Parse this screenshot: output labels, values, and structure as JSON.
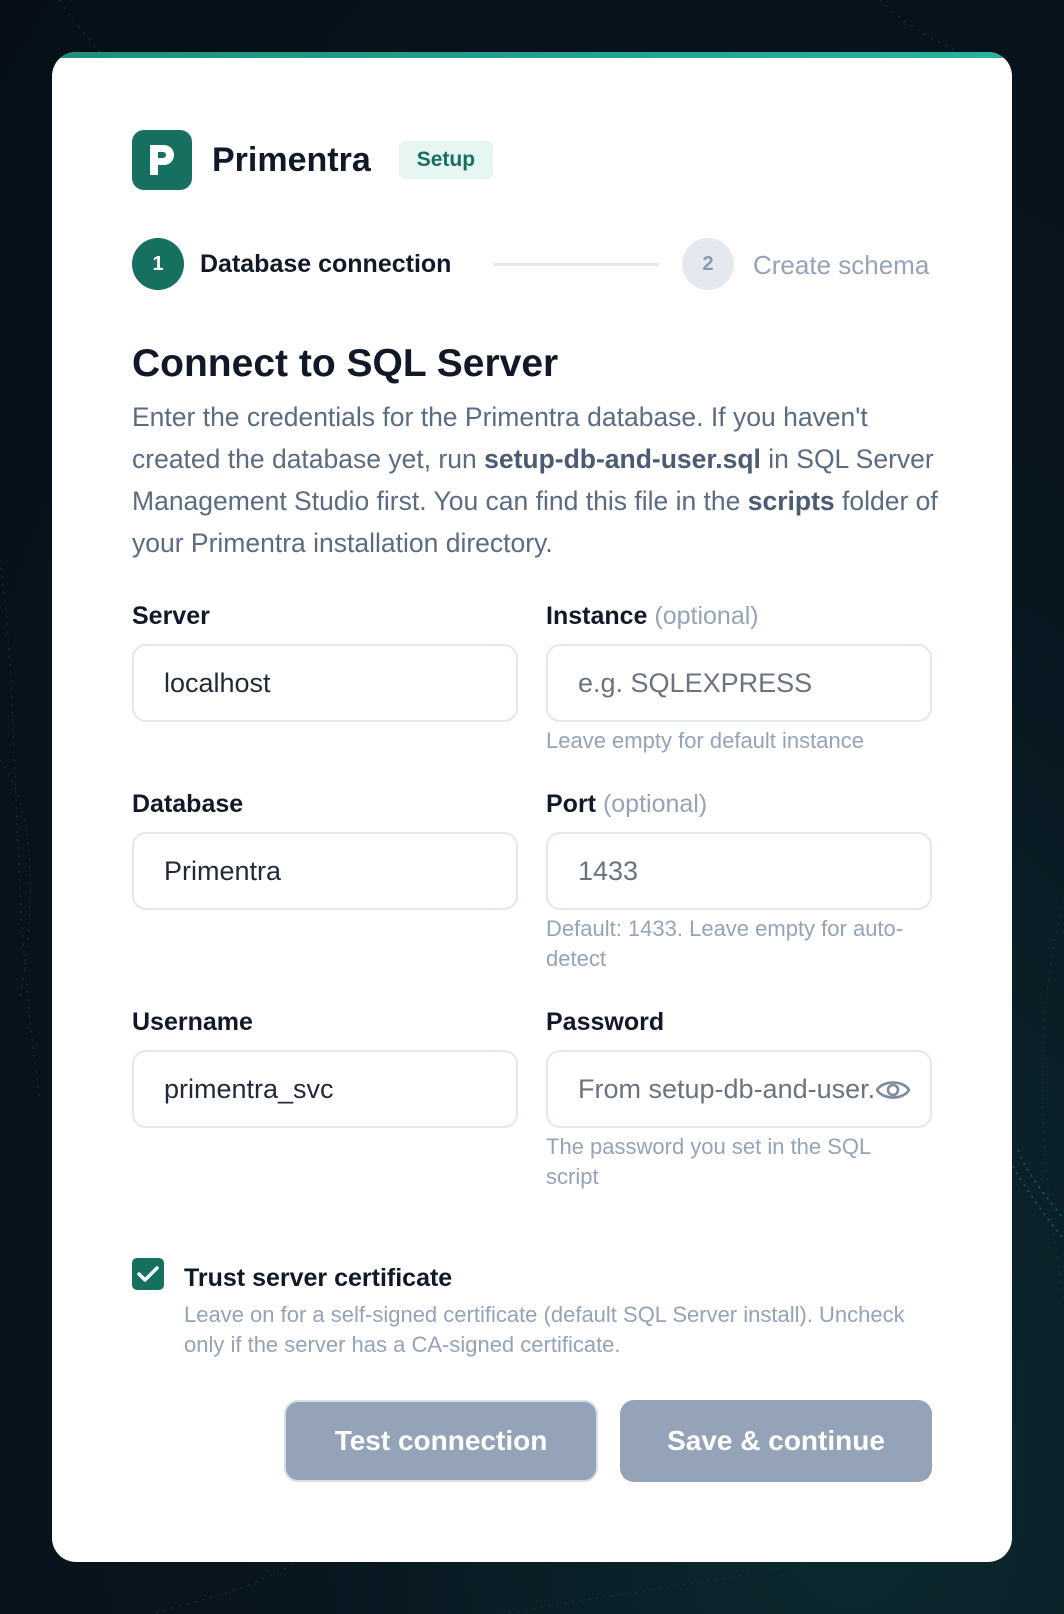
{
  "brand": {
    "name": "Primentra",
    "badge": "Setup",
    "logo_letter": "P"
  },
  "stepper": {
    "steps": [
      {
        "number": "1",
        "label": "Database connection",
        "state": "active"
      },
      {
        "number": "2",
        "label": "Create schema",
        "state": "inactive"
      }
    ]
  },
  "page": {
    "title": "Connect to SQL Server",
    "desc_1": "Enter the credentials for the Primentra database. If you haven't created the database yet, run ",
    "desc_file": "setup-db-and-user.sql",
    "desc_2": " in SQL Server Management Studio first. You can find this file in the ",
    "desc_folder": "scripts",
    "desc_3": " folder of your Primentra installation directory."
  },
  "form": {
    "server": {
      "label": "Server",
      "value": "localhost"
    },
    "instance": {
      "label": "Instance",
      "optional": "(optional)",
      "placeholder": "e.g. SQLEXPRESS",
      "hint": "Leave empty for default instance"
    },
    "database": {
      "label": "Database",
      "value": "Primentra"
    },
    "port": {
      "label": "Port",
      "optional": "(optional)",
      "placeholder": "1433",
      "hint": "Default: 1433. Leave empty for auto-detect"
    },
    "username": {
      "label": "Username",
      "value": "primentra_svc"
    },
    "password": {
      "label": "Password",
      "placeholder": "From setup-db-and-user.sql",
      "hint": "The password you set in the SQL script",
      "icon": "eye-icon"
    },
    "trust_cert": {
      "label": "Trust server certificate",
      "checked": true,
      "hint": "Leave on for a self-signed certificate (default SQL Server install). Uncheck only if the server has a CA-signed certificate."
    }
  },
  "actions": {
    "test_label": "Test connection",
    "save_label": "Save & continue"
  },
  "colors": {
    "accent": "#16705f",
    "button_disabled": "#94a3b8",
    "background": "#081620"
  }
}
